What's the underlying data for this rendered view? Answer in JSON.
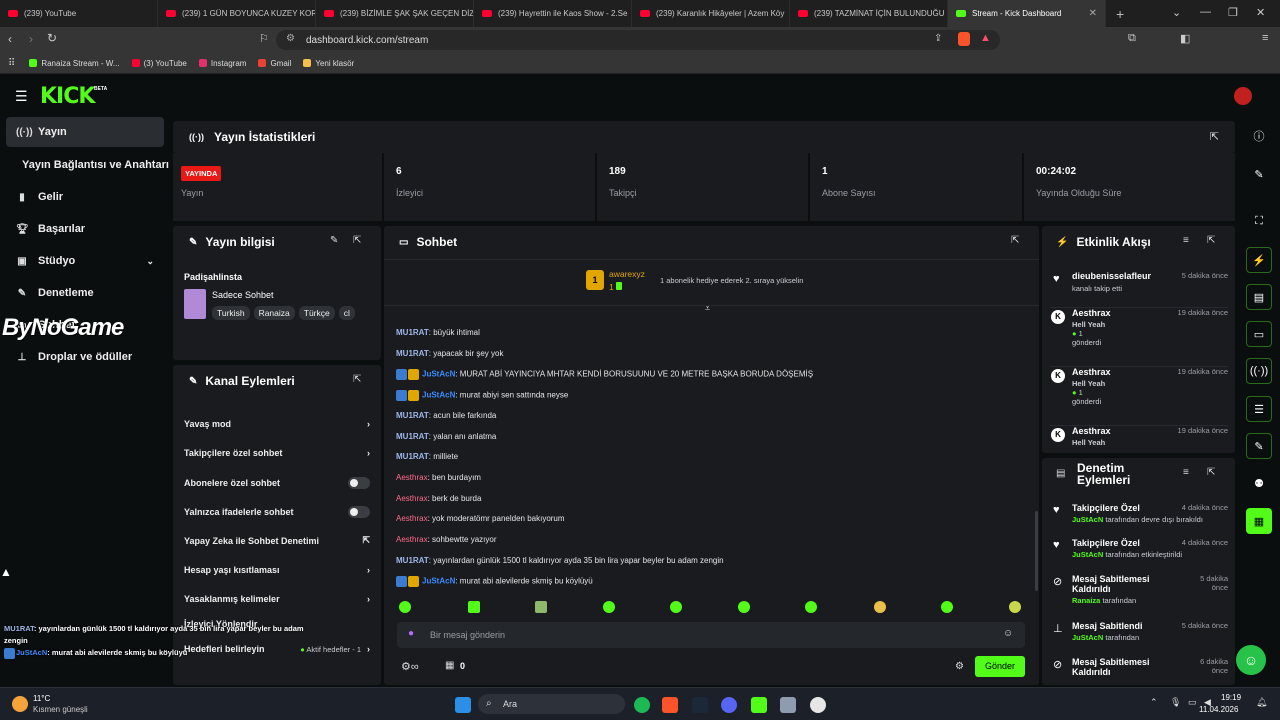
{
  "browser": {
    "tabs": [
      {
        "label": "(239) YouTube",
        "active": false
      },
      {
        "label": "(239) 1 GÜN BOYUNCA KUZEY KOR",
        "active": false
      },
      {
        "label": "(239) BİZİMLE ŞAK ŞAK GEÇEN DİZİ",
        "active": false
      },
      {
        "label": "(239) Hayrettin ile Kaos Show - 2.Se",
        "active": false
      },
      {
        "label": "(239) Karanlık Hikâyeler | Azem Köy",
        "active": false
      },
      {
        "label": "(239) TAZMİNAT İÇİN BULUNDUĞU",
        "active": false
      },
      {
        "label": "Stream - Kick Dashboard",
        "active": true
      }
    ],
    "url": "dashboard.kick.com/stream",
    "bookmarks": [
      {
        "label": "Ranaiza Stream - W...",
        "color": "#53fc18"
      },
      {
        "label": "(3) YouTube",
        "color": "#ff0033"
      },
      {
        "label": "Instagram",
        "color": "#e1306c"
      },
      {
        "label": "Gmail",
        "color": "#ea4335"
      },
      {
        "label": "Yeni klasör",
        "color": "#f3c04b"
      }
    ]
  },
  "app": {
    "logo": "KICK",
    "logo_sup": "BETA",
    "sidebar": [
      {
        "label": "Yayın",
        "icon": "broadcast-icon",
        "active": true
      },
      {
        "label": "Yayın Bağlantısı ve Anahtarı",
        "icon": "",
        "active": false
      },
      {
        "label": "Gelir",
        "icon": "bar-chart-icon",
        "active": false
      },
      {
        "label": "Başarılar",
        "icon": "trophy-icon",
        "active": false
      },
      {
        "label": "Stüdyo",
        "icon": "studio-icon",
        "active": false
      },
      {
        "label": "Denetleme",
        "icon": "wrench-icon",
        "active": false
      },
      {
        "label": "Sohbet",
        "icon": "chat-icon",
        "active": false
      },
      {
        "label": "Droplar ve ödüller",
        "icon": "drops-icon",
        "active": false
      }
    ],
    "watermark": "ByNoGame",
    "stats": {
      "title": "Yayın İstatistikleri",
      "live_badge": "YAYINDA",
      "live_label": "Yayın",
      "viewers": {
        "value": "6",
        "label": "İzleyici"
      },
      "followers": {
        "value": "189",
        "label": "Takipçi"
      },
      "subs": {
        "value": "1",
        "label": "Abone Sayısı"
      },
      "uptime": {
        "value": "00:24:02",
        "label": "Yayında Olduğu Süre"
      }
    },
    "info": {
      "title": "Yayın bilgisi",
      "stream_title": "Padişahlinsta",
      "category": "Sadece Sohbet",
      "tags": [
        "Turkish",
        "Ranaiza",
        "Türkçe",
        "cl"
      ]
    },
    "actions": {
      "title": "Kanal Eylemleri",
      "items": [
        {
          "label": "Yavaş mod",
          "control": "chevron"
        },
        {
          "label": "Takipçilere özel sohbet",
          "control": "chevron"
        },
        {
          "label": "Abonelere özel sohbet",
          "control": "toggle"
        },
        {
          "label": "Yalnızca ifadelerle sohbet",
          "control": "toggle"
        },
        {
          "label": "Yapay Zeka ile Sohbet Denetimi",
          "control": "external"
        },
        {
          "label": "Hesap yaşı kısıtlaması",
          "control": "chevron"
        },
        {
          "label": "Yasaklanmış kelimeler",
          "control": "chevron"
        },
        {
          "label": "İzleyici Yönlendir",
          "control": "none"
        },
        {
          "label": "Hedefleri belirleyin",
          "control": "goal"
        }
      ],
      "goal_badge": "Aktif hedefler - 1"
    },
    "chat": {
      "title": "Sohbet",
      "gifter_name": "awarexyz",
      "gifter_count": "1",
      "gifter_rank": "1",
      "gifter_text": "1 abonelik hediye ederek 2. sıraya yükselin",
      "messages": [
        {
          "user": "MU1RAT",
          "cls": "u-g",
          "badges": false,
          "text": "büyük ihtimal"
        },
        {
          "user": "MU1RAT",
          "cls": "u-g",
          "badges": false,
          "text": "yapacak bir şey yok"
        },
        {
          "user": "JuStAcN",
          "cls": "u-b",
          "badges": true,
          "text": "MURAT ABİ YAYINCIYA MHTAR KENDİ BORUSUUNU VE 20 METRE BAŞKA BORUDA DÖŞEMİŞ"
        },
        {
          "user": "JuStAcN",
          "cls": "u-b",
          "badges": true,
          "text": "murat abiyi sen sattında neyse"
        },
        {
          "user": "MU1RAT",
          "cls": "u-g",
          "badges": false,
          "text": "acun bile farkında"
        },
        {
          "user": "MU1RAT",
          "cls": "u-g",
          "badges": false,
          "text": "yalan anı anlatma"
        },
        {
          "user": "MU1RAT",
          "cls": "u-g",
          "badges": false,
          "text": "milliete"
        },
        {
          "user": "Aesthrax",
          "cls": "u-r",
          "badges": false,
          "text": "ben burdayım"
        },
        {
          "user": "Aesthrax",
          "cls": "u-r",
          "badges": false,
          "text": "berk de burda"
        },
        {
          "user": "Aesthrax",
          "cls": "u-r",
          "badges": false,
          "text": "yok moderatömr panelden bakıyorum"
        },
        {
          "user": "Aesthrax",
          "cls": "u-r",
          "badges": false,
          "text": "sohbewtte yazıyor"
        },
        {
          "user": "MU1RAT",
          "cls": "u-g",
          "badges": false,
          "text": "yayınlardan günlük 1500 tl kaldırıyor ayda 35 bin lira yapar beyler bu adam zengin"
        },
        {
          "user": "JuStAcN",
          "cls": "u-b",
          "badges": true,
          "text": "murat abi alevilerde skmiş bu köylüyü"
        }
      ],
      "input_placeholder": "Bir mesaj gönderin",
      "points": "0",
      "send_label": "Gönder"
    },
    "events": {
      "title": "Etkinlik Akışı",
      "items": [
        {
          "name": "dieubenisselafleur",
          "time": "5 dakika önce",
          "line1": "kanalı takip etti",
          "line2": "",
          "line3": ""
        },
        {
          "name": "Aesthrax",
          "time": "19 dakika önce",
          "line1": "Hell Yeah",
          "line2": "1",
          "line3": "gönderdi"
        },
        {
          "name": "Aesthrax",
          "time": "19 dakika önce",
          "line1": "Hell Yeah",
          "line2": "1",
          "line3": "gönderdi"
        },
        {
          "name": "Aesthrax",
          "time": "19 dakika önce",
          "line1": "Hell Yeah",
          "line2": "",
          "line3": ""
        }
      ]
    },
    "modlog": {
      "title": "Denetim Eylemleri",
      "items": [
        {
          "name": "Takipçilere Özel",
          "time": "4 dakika önce",
          "who": "JuStAcN",
          "rest": "tarafından devre dışı bırakıldı"
        },
        {
          "name": "Takipçilere Özel",
          "time": "4 dakika önce",
          "who": "JuStAcN",
          "rest": "tarafından etkinleştirildi"
        },
        {
          "name": "Mesaj Sabitlemesi Kaldırıldı",
          "time": "5 dakika önce",
          "who": "Ranaiza",
          "rest": "tarafından"
        },
        {
          "name": "Mesaj Sabitlendi",
          "time": "5 dakika önce",
          "who": "JuStAcN",
          "rest": "tarafından"
        },
        {
          "name": "Mesaj Sabitlemesi Kaldırıldı",
          "time": "6 dakika önce",
          "who": "",
          "rest": ""
        }
      ]
    },
    "overlay": [
      {
        "user": "MU1RAT",
        "text": ": yayınlardan günlük 1500 tl kaldırıyor ayda 35 bin lira yapar beyler bu adam zengin"
      },
      {
        "user": "JuStAcN",
        "text": ": murat abi alevilerde skmiş bu köylüyü"
      }
    ]
  },
  "taskbar": {
    "weather_temp": "11°C",
    "weather_text": "Kısmen güneşli",
    "search": "Ara",
    "time": "19:19",
    "date": "11.04.2026"
  }
}
